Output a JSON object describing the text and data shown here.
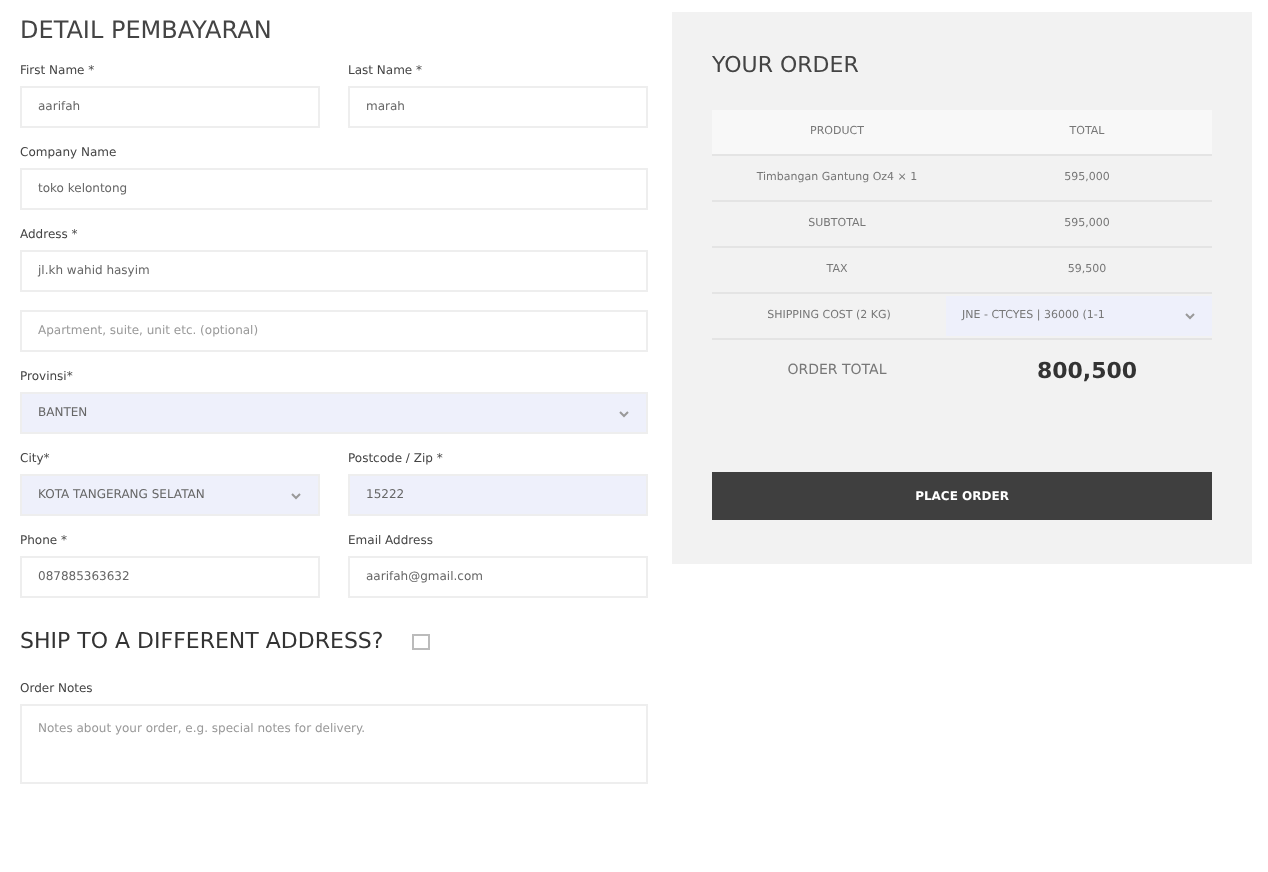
{
  "billing": {
    "title": "DETAIL PEMBAYARAN",
    "rows": [
      [
        {
          "label": "First Name *",
          "kind": "input",
          "value": "aarifah"
        },
        {
          "label": "Last Name *",
          "kind": "input",
          "value": "marah"
        }
      ],
      [
        {
          "label": "Company Name",
          "kind": "input",
          "value": "toko kelontong"
        }
      ],
      [
        {
          "label": "Address *",
          "kind": "input",
          "value": "jl.kh wahid hasyim"
        }
      ],
      [
        {
          "kind": "input",
          "placeholder": "Apartment, suite, unit etc. (optional)"
        }
      ],
      [
        {
          "label": "Provinsi*",
          "kind": "select",
          "value": "BANTEN"
        }
      ],
      [
        {
          "label": "City*",
          "kind": "select",
          "value": "KOTA TANGERANG SELATAN"
        },
        {
          "label": "Postcode / Zip *",
          "kind": "input",
          "value": "15222",
          "filled": true
        }
      ],
      [
        {
          "label": "Phone *",
          "kind": "input",
          "value": "087885363632"
        },
        {
          "label": "Email Address",
          "kind": "input",
          "value": "aarifah@gmail.com"
        }
      ]
    ],
    "ship_different": {
      "label": "SHIP TO A DIFFERENT ADDRESS?",
      "checked": false
    },
    "notes": {
      "label": "Order Notes",
      "placeholder": "Notes about your order, e.g. special notes for delivery."
    }
  },
  "order": {
    "title": "YOUR ORDER",
    "columns": [
      "PRODUCT",
      "TOTAL"
    ],
    "rows": [
      {
        "kind": "text",
        "label": "Timbangan Gantung Oz4 × 1",
        "value": "595,000"
      },
      {
        "kind": "text",
        "label": "SUBTOTAL",
        "value": "595,000"
      },
      {
        "kind": "text",
        "label": "TAX",
        "value": "59,500"
      },
      {
        "kind": "select",
        "label": "SHIPPING COST (2 KG)",
        "value": "JNE - CTCYES | 36000 (1-1"
      }
    ],
    "total_label": "ORDER TOTAL",
    "total": "800,500",
    "button": "PLACE ORDER"
  }
}
